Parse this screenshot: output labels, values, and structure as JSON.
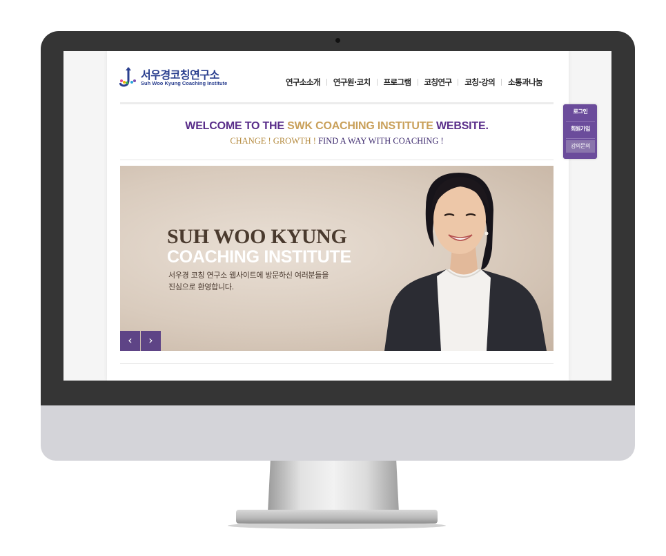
{
  "site": {
    "logo": {
      "title": "서우경코칭연구소",
      "subtitle": "Suh Woo Kyung Coaching Institute"
    },
    "nav": [
      {
        "label": "연구소소개"
      },
      {
        "label": "연구원·코치"
      },
      {
        "label": "프로그램"
      },
      {
        "label": "코칭연구"
      },
      {
        "label": "코칭·강의"
      },
      {
        "label": "소통과나눔"
      }
    ],
    "welcome": {
      "part1": "WELCOME TO THE ",
      "part2": "SWK COACHING INSTITUTE",
      "part3": " WEBSITE.",
      "tag1": "CHANGE ! GROWTH ! ",
      "tag2": "FIND A WAY WITH COACHING !"
    },
    "hero": {
      "title1": "SUH WOO KYUNG",
      "title2": "COACHING INSTITUTE",
      "desc1": "서우경 코칭 연구소 웹사이트에 방문하신 여러분들을",
      "desc2": "진심으로 환영합니다.",
      "prev_label": "‹",
      "next_label": "›"
    },
    "quick_menu": [
      {
        "label": "로그인"
      },
      {
        "label": "회원가입"
      },
      {
        "label": "강의문의"
      }
    ]
  },
  "colors": {
    "brand_purple": "#5a2e8a",
    "brand_gold": "#c9a05a",
    "logo_blue": "#2a3f8f",
    "bezel": "#353535"
  }
}
